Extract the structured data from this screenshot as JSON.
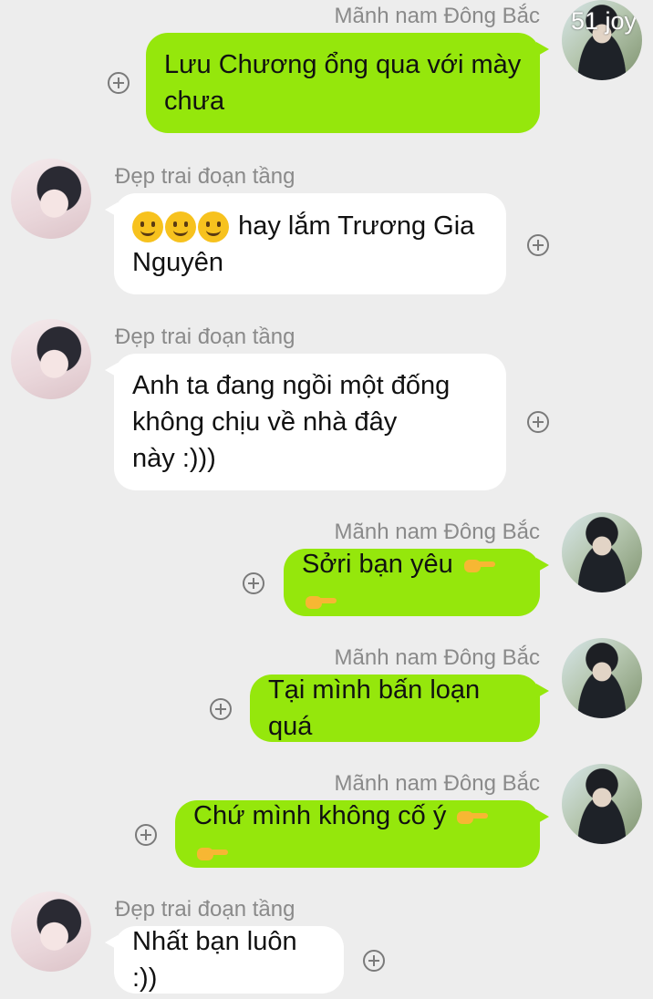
{
  "messages": [
    {
      "side": "right",
      "sender": "Mãnh nam Đông Bắc",
      "avatar_label": "51 joy",
      "lines": [
        "Lưu Chương ổng qua với mày",
        "chưa"
      ]
    },
    {
      "side": "left",
      "sender": "Đẹp trai đoạn tầng",
      "lines": [
        "hay lắm Trương Gia",
        "Nguyên"
      ],
      "emoji": [
        "smile-emoji",
        "smile-emoji",
        "smile-emoji"
      ]
    },
    {
      "side": "left",
      "sender": "Đẹp trai đoạn tầng",
      "lines": [
        "Anh ta đang ngồi một đống",
        "không chịu về nhà đây",
        "này :)))"
      ]
    },
    {
      "side": "right",
      "sender": "Mãnh nam Đông Bắc",
      "lines": [
        "Sởri bạn yêu"
      ],
      "trailing_icons": [
        "pointing-hand-icon",
        "pointing-hand-icon"
      ]
    },
    {
      "side": "right",
      "sender": "Mãnh nam Đông Bắc",
      "lines": [
        "Tại mình bấn loạn quá"
      ]
    },
    {
      "side": "right",
      "sender": "Mãnh nam Đông Bắc",
      "lines": [
        "Chứ mình không cố ý"
      ],
      "trailing_icons": [
        "pointing-hand-icon",
        "pointing-hand-icon"
      ]
    },
    {
      "side": "left",
      "sender": "Đẹp trai đoạn tầng",
      "lines": [
        "Nhất bạn luôn :))"
      ]
    }
  ],
  "colors": {
    "background": "#ededed",
    "outgoing_bubble": "#95e70c",
    "incoming_bubble": "#ffffff",
    "sender_name": "#8a8a8a"
  }
}
